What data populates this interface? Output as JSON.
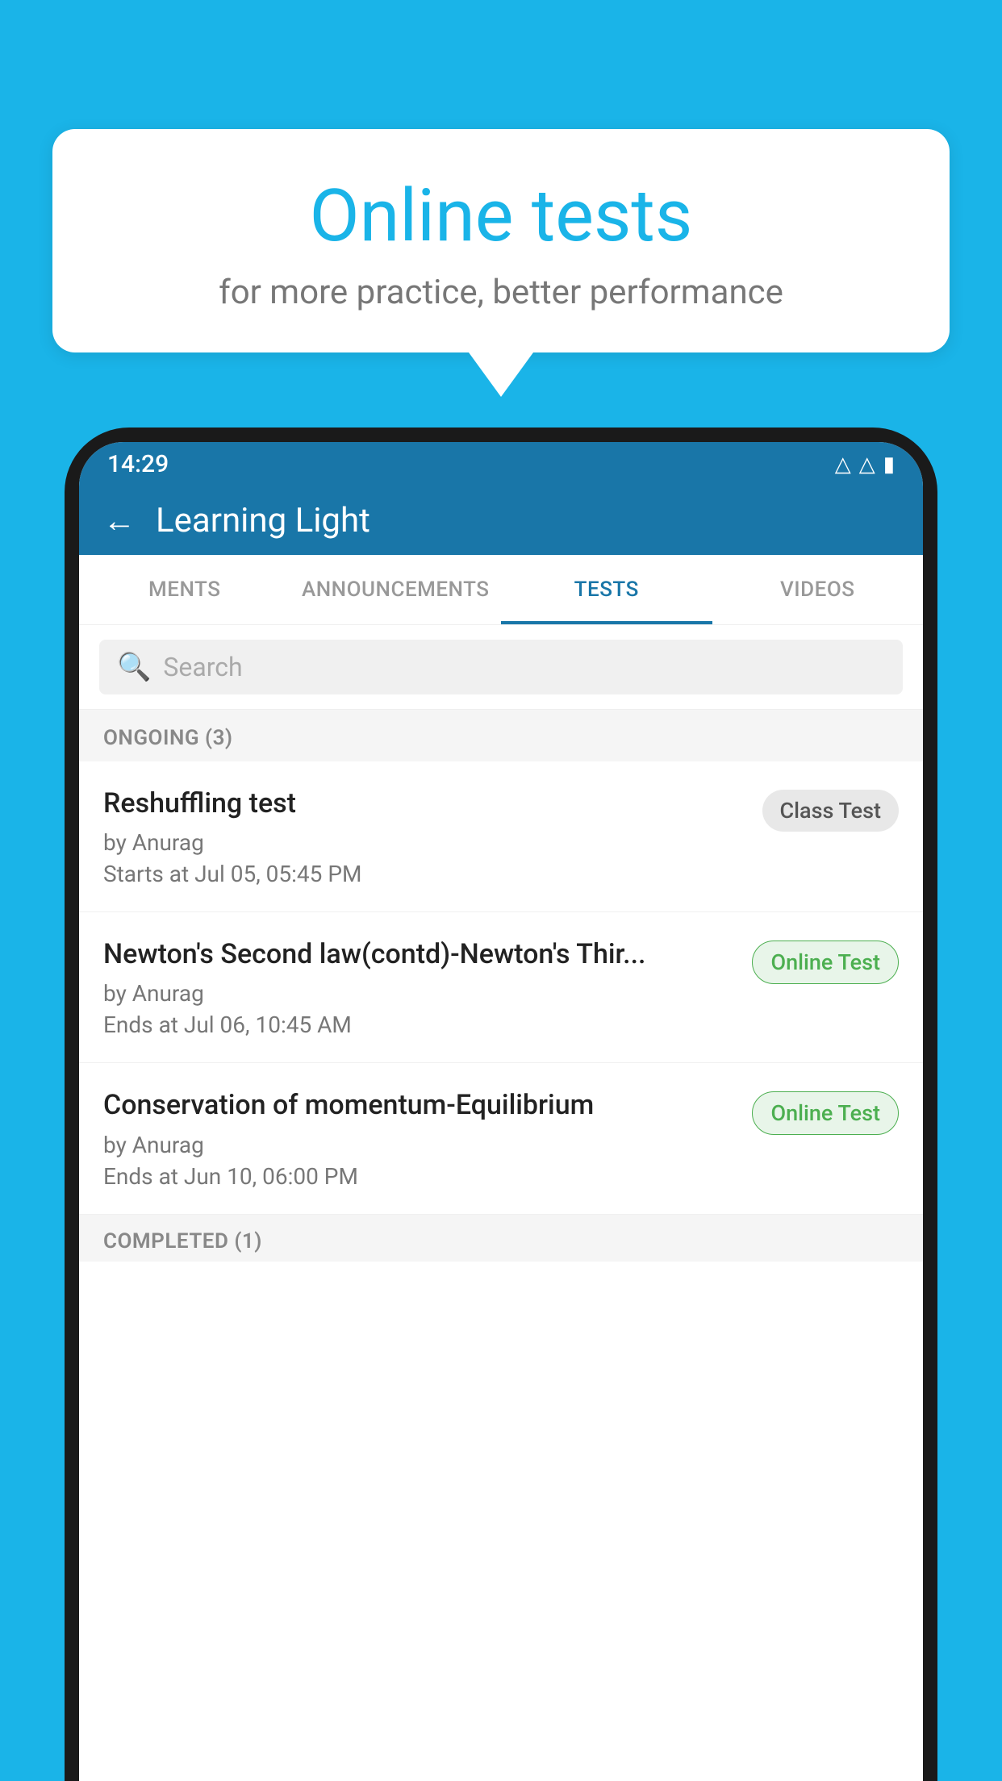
{
  "background_color": "#1ab4e8",
  "speech_bubble": {
    "title": "Online tests",
    "subtitle": "for more practice, better performance"
  },
  "phone": {
    "status_bar": {
      "time": "14:29",
      "wifi_icon": "▾",
      "signal_icon": "▾",
      "battery_icon": "▮"
    },
    "header": {
      "back_label": "←",
      "title": "Learning Light"
    },
    "tabs": [
      {
        "label": "MENTS",
        "active": false
      },
      {
        "label": "ANNOUNCEMENTS",
        "active": false
      },
      {
        "label": "TESTS",
        "active": true
      },
      {
        "label": "VIDEOS",
        "active": false
      }
    ],
    "search": {
      "placeholder": "Search"
    },
    "sections": [
      {
        "label": "ONGOING (3)",
        "items": [
          {
            "name": "Reshuffling test",
            "author": "by Anurag",
            "date": "Starts at  Jul 05, 05:45 PM",
            "badge": "Class Test",
            "badge_type": "class"
          },
          {
            "name": "Newton's Second law(contd)-Newton's Thir...",
            "author": "by Anurag",
            "date": "Ends at  Jul 06, 10:45 AM",
            "badge": "Online Test",
            "badge_type": "online"
          },
          {
            "name": "Conservation of momentum-Equilibrium",
            "author": "by Anurag",
            "date": "Ends at  Jun 10, 06:00 PM",
            "badge": "Online Test",
            "badge_type": "online"
          }
        ]
      }
    ],
    "bottom_section_label": "COMPLETED (1)"
  }
}
